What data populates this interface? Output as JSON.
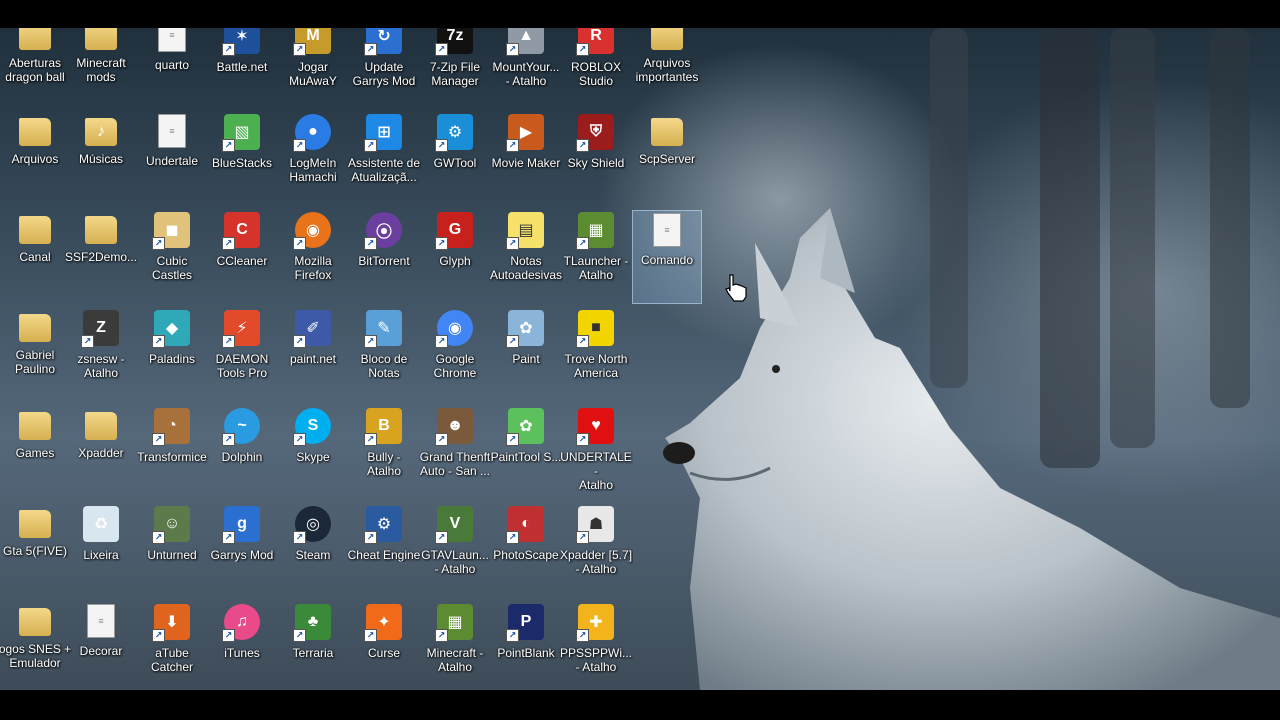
{
  "desktop": {
    "icons": [
      {
        "label": "Aberturas\ndragon ball",
        "icon": "folder-icon",
        "color": "#b07bd0"
      },
      {
        "label": "Minecraft\nmods",
        "icon": "folder-icon",
        "color": "#e8c66a"
      },
      {
        "label": "quarto",
        "icon": "document-icon",
        "color": "#f4f4f4"
      },
      {
        "label": "Battle.net",
        "icon": "battlenet-icon",
        "color": "#1d4f9a"
      },
      {
        "label": "Jogar\nMuAwaY",
        "icon": "muaway-icon",
        "color": "#c79a2c"
      },
      {
        "label": "Update\nGarrys Mod",
        "icon": "update-gmod-icon",
        "color": "#2b6fd1"
      },
      {
        "label": "7-Zip File\nManager",
        "icon": "7zip-icon",
        "color": "#111111"
      },
      {
        "label": "MountYour...\n- Atalho",
        "icon": "mountyour-icon",
        "color": "#8f9aa6"
      },
      {
        "label": "ROBLOX\nStudio",
        "icon": "roblox-studio-icon",
        "color": "#d93030"
      },
      {
        "label": "Arquivos\nimportantes",
        "icon": "folder-icon",
        "color": "#e8c66a"
      },
      {
        "label": "Arquivos",
        "icon": "folder-icon",
        "color": "#e8c66a"
      },
      {
        "label": "Músicas",
        "icon": "folder-music-icon",
        "color": "#e8c66a"
      },
      {
        "label": "Undertale",
        "icon": "document-icon",
        "color": "#f4f4f4"
      },
      {
        "label": "BlueStacks",
        "icon": "bluestacks-icon",
        "color": "#4caf50"
      },
      {
        "label": "LogMeIn\nHamachi",
        "icon": "hamachi-icon",
        "color": "#2a7be4"
      },
      {
        "label": "Assistente de\nAtualizaçã...",
        "icon": "windows-icon",
        "color": "#1e88e5"
      },
      {
        "label": "GWTool",
        "icon": "gear-icon",
        "color": "#1a8fd8"
      },
      {
        "label": "Movie Maker",
        "icon": "movie-maker-icon",
        "color": "#c85a1e"
      },
      {
        "label": "Sky Shield",
        "icon": "sky-shield-icon",
        "color": "#9b1c1c"
      },
      {
        "label": "ScpServer",
        "icon": "folder-icon",
        "color": "#e8c66a"
      },
      {
        "label": "Canal",
        "icon": "folder-icon",
        "color": "#e8c66a"
      },
      {
        "label": "SSF2Demo...",
        "icon": "folder-icon",
        "color": "#e8c66a"
      },
      {
        "label": "Cubic Castles",
        "icon": "cubic-castles-icon",
        "color": "#e0c27a"
      },
      {
        "label": "CCleaner",
        "icon": "ccleaner-icon",
        "color": "#d6332a"
      },
      {
        "label": "Mozilla\nFirefox",
        "icon": "firefox-icon",
        "color": "#e8731a"
      },
      {
        "label": "BitTorrent",
        "icon": "bittorrent-icon",
        "color": "#6b3fa0"
      },
      {
        "label": "Glyph",
        "icon": "glyph-icon",
        "color": "#c8201c"
      },
      {
        "label": "Notas\nAutoadesivas",
        "icon": "sticky-notes-icon",
        "color": "#f6e26b"
      },
      {
        "label": "TLauncher -\nAtalho",
        "icon": "minecraft-block-icon",
        "color": "#5b8c32"
      },
      {
        "label": "Comando",
        "icon": "document-icon",
        "color": "#f4f4f4"
      },
      {
        "label": "Gabriel\nPaulino",
        "icon": "folder-icon",
        "color": "#e8c66a"
      },
      {
        "label": "zsnesw -\nAtalho",
        "icon": "zsnes-icon",
        "color": "#3b3b3b"
      },
      {
        "label": "Paladins",
        "icon": "paladins-icon",
        "color": "#2fa8b8"
      },
      {
        "label": "DAEMON\nTools Pro",
        "icon": "daemon-tools-icon",
        "color": "#e24a2a"
      },
      {
        "label": "paint.net",
        "icon": "paintnet-icon",
        "color": "#3c5aa8"
      },
      {
        "label": "Bloco de\nNotas",
        "icon": "notepad-icon",
        "color": "#5aa0d8"
      },
      {
        "label": "Google\nChrome",
        "icon": "chrome-icon",
        "color": "#4285f4"
      },
      {
        "label": "Paint",
        "icon": "paint-icon",
        "color": "#8ab4d8"
      },
      {
        "label": "Trove North\nAmerica",
        "icon": "trove-icon",
        "color": "#f2d400"
      },
      {
        "label": "Games",
        "icon": "folder-icon",
        "color": "#e8c66a"
      },
      {
        "label": "Xpadder",
        "icon": "folder-icon",
        "color": "#e8c66a"
      },
      {
        "label": "Transformice",
        "icon": "transformice-icon",
        "color": "#a8703a"
      },
      {
        "label": "Dolphin",
        "icon": "dolphin-icon",
        "color": "#2a9be0"
      },
      {
        "label": "Skype",
        "icon": "skype-icon",
        "color": "#00aff0"
      },
      {
        "label": "Bully -\nAtalho",
        "icon": "bully-icon",
        "color": "#d8a420"
      },
      {
        "label": "Grand Thenft\nAuto - San ...",
        "icon": "gta-sa-icon",
        "color": "#7a5a3a"
      },
      {
        "label": "PaintTool S...",
        "icon": "painttool-sai-icon",
        "color": "#5cc05c"
      },
      {
        "label": "UNDERTALE -\nAtalho",
        "icon": "heart-icon",
        "color": "#e01010"
      },
      {
        "label": "Gta 5(FIVE)",
        "icon": "folder-icon",
        "color": "#e8c66a"
      },
      {
        "label": "Lixeira",
        "icon": "recycle-bin-icon",
        "color": "#d8e6f0"
      },
      {
        "label": "Unturned",
        "icon": "unturned-icon",
        "color": "#5c7a4a"
      },
      {
        "label": "Garrys Mod",
        "icon": "garrys-mod-icon",
        "color": "#2b6fd1"
      },
      {
        "label": "Steam",
        "icon": "steam-icon",
        "color": "#1b2838"
      },
      {
        "label": "Cheat Engine",
        "icon": "cheat-engine-icon",
        "color": "#2a5aa0"
      },
      {
        "label": "GTAVLaun...\n- Atalho",
        "icon": "gtav-icon",
        "color": "#4a7a3a"
      },
      {
        "label": "PhotoScape",
        "icon": "photoscape-icon",
        "color": "#c03030"
      },
      {
        "label": "Xpadder [5.7]\n- Atalho",
        "icon": "gamepad-icon",
        "color": "#e8e8e8"
      },
      {
        "label": "ogos SNES +\nEmulador",
        "icon": "folder-icon",
        "color": "#e8c66a"
      },
      {
        "label": "Decorar",
        "icon": "document-icon",
        "color": "#f4f4f4"
      },
      {
        "label": "aTube\nCatcher",
        "icon": "atube-catcher-icon",
        "color": "#e0641e"
      },
      {
        "label": "iTunes",
        "icon": "itunes-icon",
        "color": "#e84a8a"
      },
      {
        "label": "Terraria",
        "icon": "terraria-icon",
        "color": "#3a8a3a"
      },
      {
        "label": "Curse",
        "icon": "curse-icon",
        "color": "#f06a1a"
      },
      {
        "label": "Minecraft -\nAtalho",
        "icon": "minecraft-block-icon",
        "color": "#5b8c32"
      },
      {
        "label": "PointBlank",
        "icon": "pointblank-icon",
        "color": "#1a2a6a"
      },
      {
        "label": "PPSSPPWi...\n- Atalho",
        "icon": "ppsspp-icon",
        "color": "#f2b41a"
      }
    ]
  }
}
